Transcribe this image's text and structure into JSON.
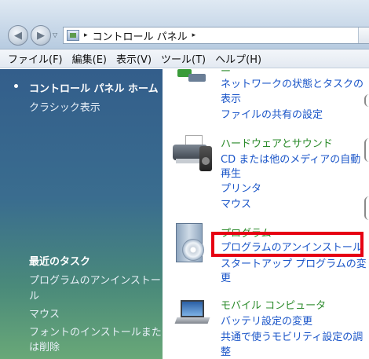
{
  "address_bar": {
    "path_label": "コントロール パネル",
    "separator_glyph": "▸",
    "back_glyph": "◀",
    "forward_glyph": "▶",
    "dropdown_glyph": "▽"
  },
  "menubar": {
    "items": [
      "ファイル(F)",
      "編集(E)",
      "表示(V)",
      "ツール(T)",
      "ヘルプ(H)"
    ]
  },
  "left_pane": {
    "home_link": "コントロール パネル ホーム",
    "classic_link": "クラシック表示",
    "recent_tasks_heading": "最近のタスク",
    "recent_tasks": [
      "プログラムのアンインストー",
      "ル",
      "マウス",
      "フォントのインストールまた",
      "は削除"
    ]
  },
  "content": {
    "network": {
      "title_partial": "ー",
      "links": [
        "ネットワークの状態とタスクの",
        "表示",
        "ファイルの共有の設定"
      ]
    },
    "hardware": {
      "title": "ハードウェアとサウンド",
      "links": [
        "CD または他のメディアの自動",
        "再生",
        "プリンタ",
        "マウス"
      ]
    },
    "programs": {
      "title": "プログラム",
      "links": [
        "プログラムのアンインストール",
        "スタートアップ プログラムの変",
        "更"
      ]
    },
    "mobile": {
      "title": "モバイル コンピュータ",
      "links": [
        "バッテリ設定の変更",
        "共通で使うモビリティ設定の調",
        "整"
      ]
    }
  },
  "colors": {
    "link_blue": "#1a55c8",
    "category_green": "#2a8a2a",
    "highlight_red": "#e60012"
  }
}
